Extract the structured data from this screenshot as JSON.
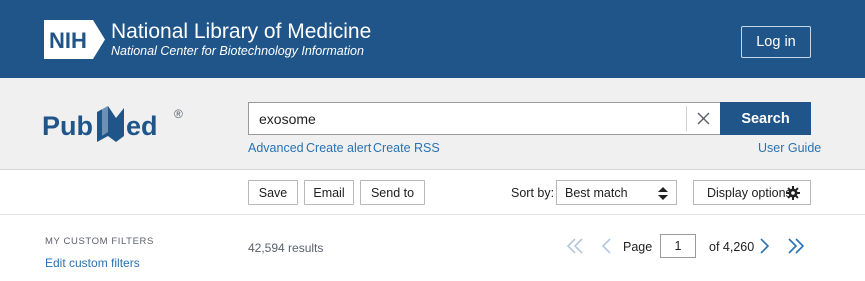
{
  "header": {
    "logo_text": "NIH",
    "title": "National Library of Medicine",
    "subtitle": "National Center for Biotechnology Information",
    "login_label": "Log in",
    "bg_color": "#20558a"
  },
  "search": {
    "logo_text": "PubMed",
    "logo_mark": "®",
    "query": "exosome",
    "clear_icon": "close-icon",
    "button_label": "Search",
    "links": {
      "advanced": "Advanced",
      "create_alert": "Create alert",
      "create_rss": "Create RSS",
      "user_guide": "User Guide"
    }
  },
  "toolbar": {
    "save": "Save",
    "email": "Email",
    "send_to": "Send to",
    "sort_label": "Sort by:",
    "sort_value": "Best match",
    "display_options": "Display options"
  },
  "filters": {
    "heading": "MY CUSTOM FILTERS",
    "edit_link": "Edit custom filters"
  },
  "results": {
    "count_text": "42,594 results",
    "page_label": "Page",
    "current_page": "1",
    "total_pages_text": "of 4,260"
  },
  "colors": {
    "accent": "#20558a",
    "link": "#2872b3",
    "pager_disabled": "#b5c7dd",
    "pager_active": "#2872b3"
  }
}
